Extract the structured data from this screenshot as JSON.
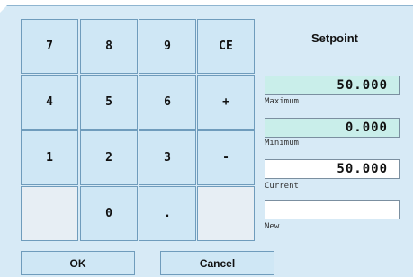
{
  "keypad": {
    "row1": [
      "7",
      "8",
      "9",
      "CE"
    ],
    "row2": [
      "4",
      "5",
      "6",
      "+"
    ],
    "row3": [
      "1",
      "2",
      "3",
      "-"
    ],
    "row4": [
      "0",
      "."
    ]
  },
  "setpoint": {
    "title": "Setpoint",
    "maximum_value": "50.000",
    "maximum_label": "Maximum",
    "minimum_value": "0.000",
    "minimum_label": "Minimum",
    "current_value": "50.000",
    "current_label": "Current",
    "new_value": "",
    "new_label": "New"
  },
  "actions": {
    "ok_label": "OK",
    "cancel_label": "Cancel"
  }
}
